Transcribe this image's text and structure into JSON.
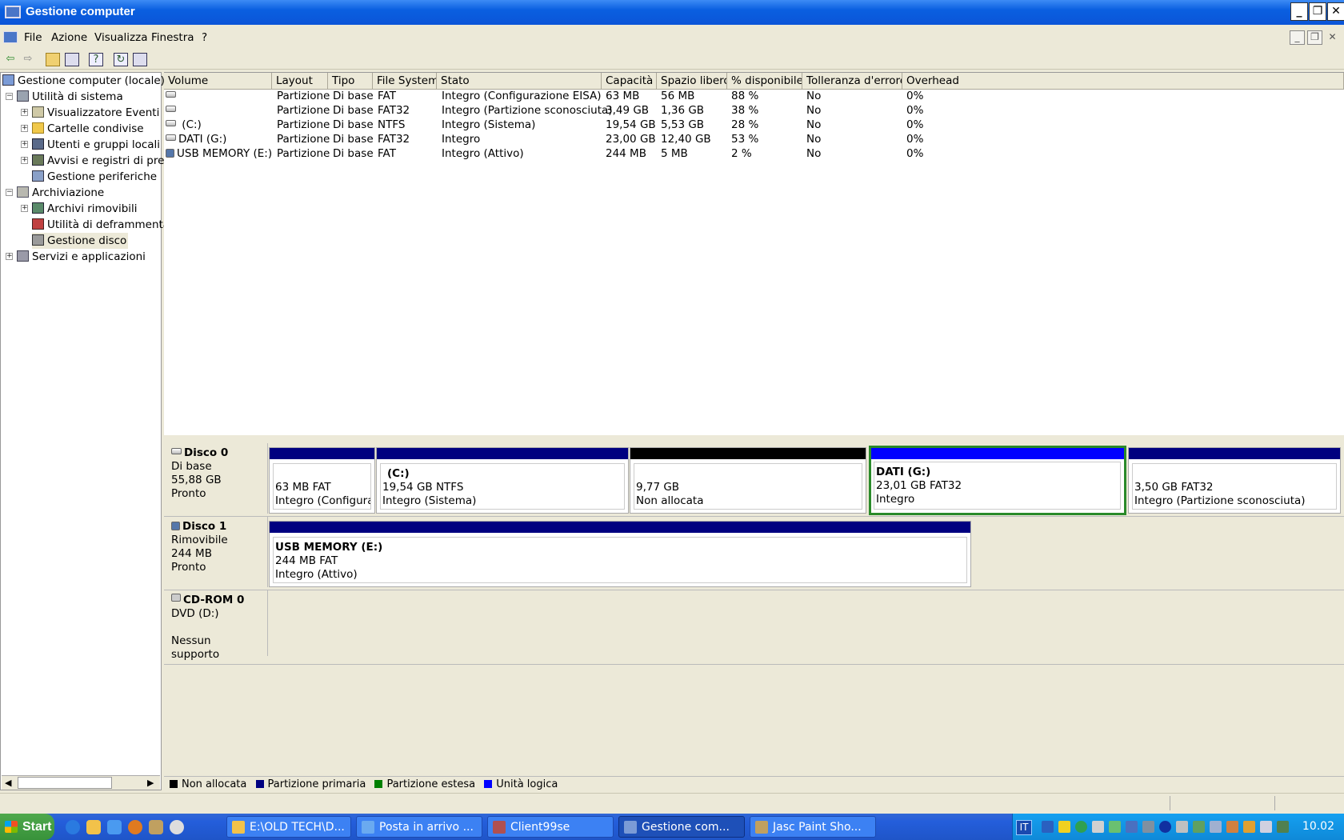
{
  "window": {
    "title": "Gestione computer"
  },
  "menu": [
    "File",
    "Azione",
    "Visualizza",
    "Finestra",
    "?"
  ],
  "tree": [
    {
      "label": "Gestione computer (locale)"
    },
    {
      "label": "Utilità di sistema"
    },
    {
      "label": "Visualizzatore Eventi"
    },
    {
      "label": "Cartelle condivise"
    },
    {
      "label": "Utenti e gruppi locali"
    },
    {
      "label": "Avvisi e registri di prest"
    },
    {
      "label": "Gestione periferiche"
    },
    {
      "label": "Archiviazione"
    },
    {
      "label": "Archivi rimovibili"
    },
    {
      "label": "Utilità di deframmentaz"
    },
    {
      "label": "Gestione disco",
      "selected": true
    },
    {
      "label": "Servizi e applicazioni"
    }
  ],
  "volumes": {
    "columns": [
      "Volume",
      "Layout",
      "Tipo",
      "File System",
      "Stato",
      "Capacità",
      "Spazio libero",
      "% disponibile",
      "Tolleranza d'errore",
      "Overhead"
    ],
    "rows": [
      [
        "",
        "Partizione",
        "Di base",
        "FAT",
        "Integro (Configurazione EISA)",
        "63 MB",
        "56 MB",
        "88 %",
        "No",
        "0%"
      ],
      [
        "",
        "Partizione",
        "Di base",
        "FAT32",
        "Integro (Partizione sconosciuta)",
        "3,49 GB",
        "1,36 GB",
        "38 %",
        "No",
        "0%"
      ],
      [
        "(C:)",
        "Partizione",
        "Di base",
        "NTFS",
        "Integro (Sistema)",
        "19,54 GB",
        "5,53 GB",
        "28 %",
        "No",
        "0%"
      ],
      [
        "DATI (G:)",
        "Partizione",
        "Di base",
        "FAT32",
        "Integro",
        "23,00 GB",
        "12,40 GB",
        "53 %",
        "No",
        "0%"
      ],
      [
        "USB MEMORY (E:)",
        "Partizione",
        "Di base",
        "FAT",
        "Integro (Attivo)",
        "244 MB",
        "5 MB",
        "2 %",
        "No",
        "0%"
      ]
    ]
  },
  "disks": [
    {
      "name": "Disco 0",
      "type": "Di base",
      "size": "55,88 GB",
      "status": "Pronto",
      "partitions": [
        {
          "title": "",
          "line1": "63 MB FAT",
          "line2": "Integro (Configuraz",
          "kind": "primary"
        },
        {
          "title": "(C:)",
          "line1": "19,54 GB NTFS",
          "line2": "Integro (Sistema)",
          "kind": "primary"
        },
        {
          "title": "",
          "line1": "9,77 GB",
          "line2": "Non allocata",
          "kind": "unallocated"
        },
        {
          "title": "DATI  (G:)",
          "line1": "23,01 GB FAT32",
          "line2": "Integro",
          "kind": "logical",
          "selected": true
        },
        {
          "title": "",
          "line1": "3,50 GB FAT32",
          "line2": "Integro (Partizione sconosciuta)",
          "kind": "primary"
        }
      ]
    },
    {
      "name": "Disco 1",
      "type": "Rimovibile",
      "size": "244 MB",
      "status": "Pronto",
      "partitions": [
        {
          "title": "USB MEMORY  (E:)",
          "line1": "244 MB FAT",
          "line2": "Integro (Attivo)",
          "kind": "primary"
        }
      ]
    },
    {
      "name": "CD-ROM 0",
      "type": "DVD (D:)",
      "size": "",
      "status": "Nessun supporto",
      "partitions": []
    }
  ],
  "legend": [
    "Non allocata",
    "Partizione primaria",
    "Partizione estesa",
    "Unità logica"
  ],
  "colors": {
    "unallocated": "#000000",
    "primary": "#000080",
    "extended": "#008000",
    "logical": "#0000ff"
  },
  "taskbar": {
    "start": "Start",
    "tasks": [
      "E:\\OLD TECH\\D...",
      "Posta in arrivo ...",
      "Client99se",
      "Gestione com...",
      "Jasc Paint Sho..."
    ],
    "lang": "IT",
    "clock": "10.02"
  }
}
